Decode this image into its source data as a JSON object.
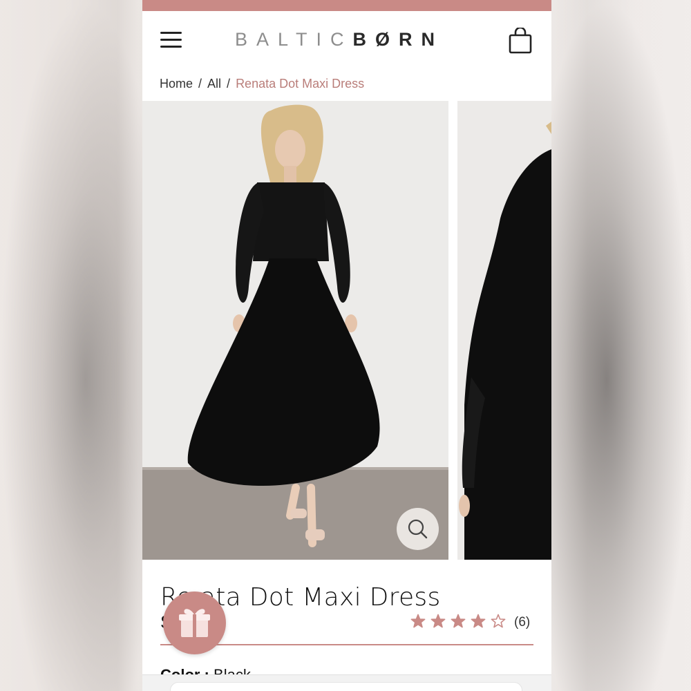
{
  "colors": {
    "accent": "#c98a86",
    "accent_text": "#b97d79",
    "text_dark": "#222222"
  },
  "header": {
    "logo_part1": "BALTIC",
    "logo_part2": "BØRN",
    "menu_icon": "hamburger-menu-icon",
    "cart_icon": "shopping-bag-icon"
  },
  "breadcrumb": {
    "items": [
      {
        "label": "Home"
      },
      {
        "label": "All"
      },
      {
        "label": "Renata Dot Maxi Dress"
      }
    ],
    "separator": "/"
  },
  "gallery": {
    "zoom_icon": "magnifier-icon"
  },
  "product": {
    "title": "Renata Dot Maxi Dress",
    "title_visible": "Re ata Dot Maxi Dress",
    "subline_visible": "S",
    "rating": 4,
    "rating_max": 5,
    "review_count": "(6)",
    "color_label": "Color :",
    "color_value": "Black"
  },
  "gift": {
    "icon": "gift-icon"
  }
}
